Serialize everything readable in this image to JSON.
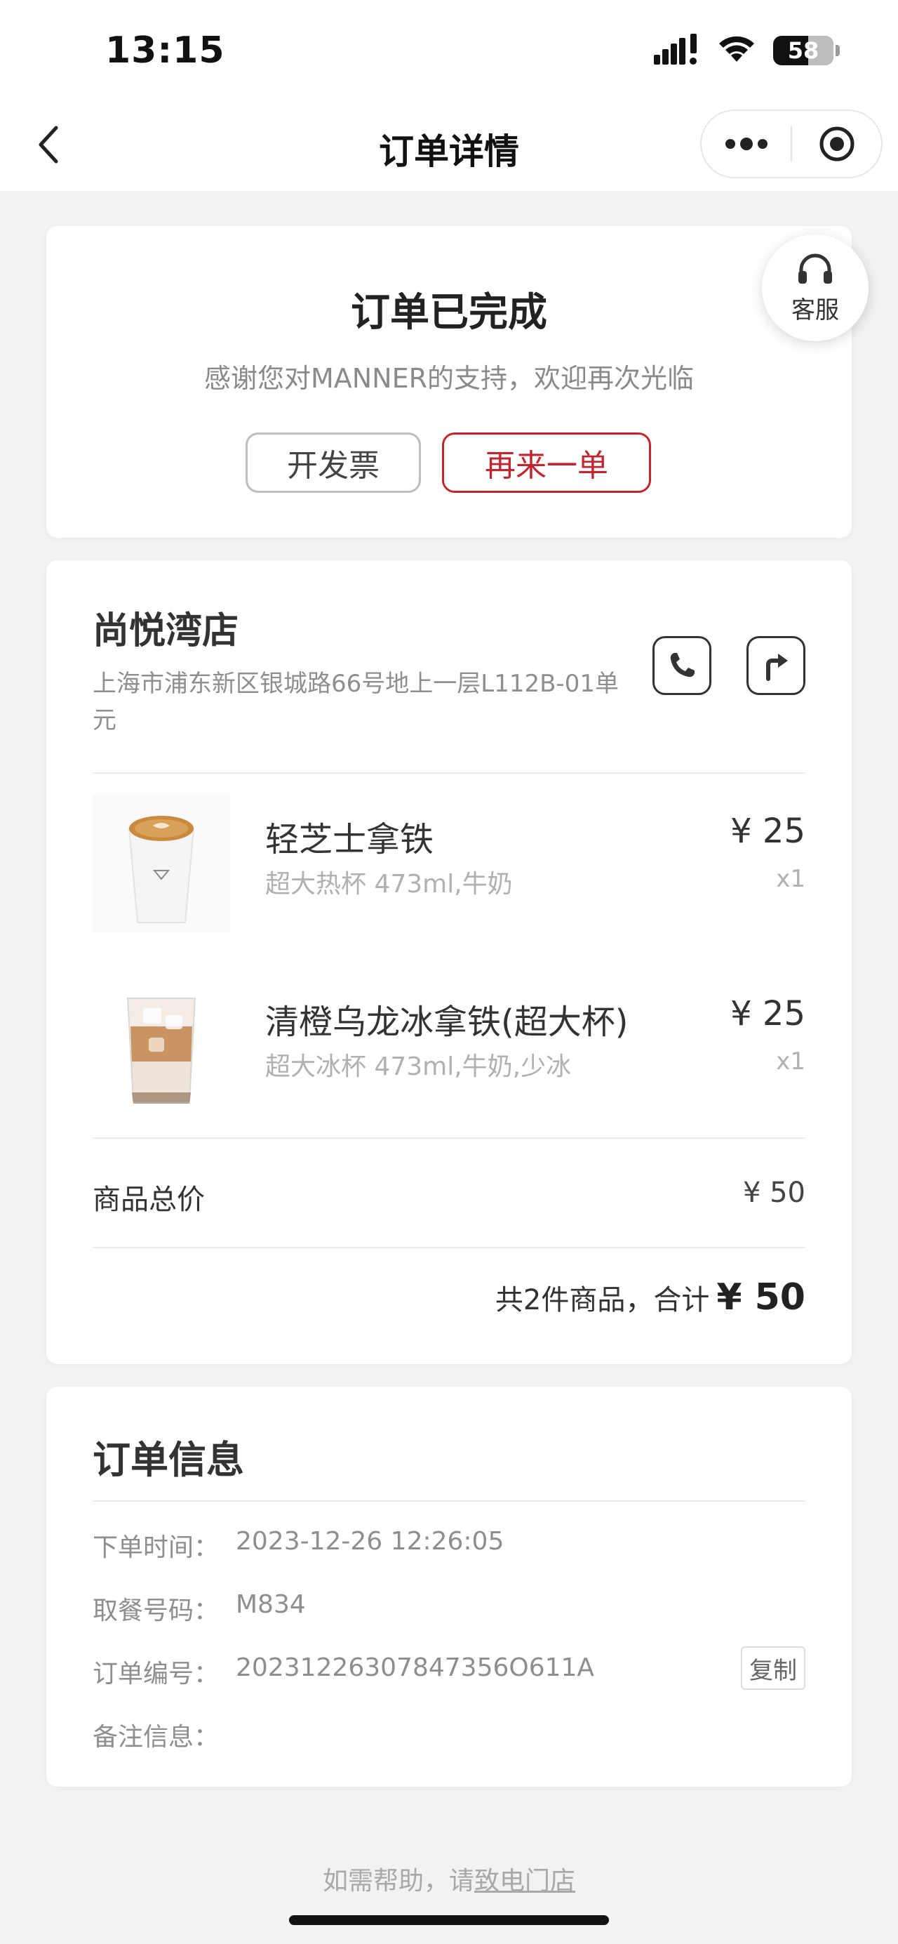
{
  "status_bar": {
    "time": "13:15",
    "battery": "58"
  },
  "nav": {
    "title": "订单详情"
  },
  "order_status": {
    "title": "订单已完成",
    "subtitle": "感谢您对MANNER的支持，欢迎再次光临",
    "invoice_label": "开发票",
    "reorder_label": "再来一单",
    "service_label": "客服"
  },
  "store": {
    "name": "尚悦湾店",
    "address": "上海市浦东新区银城路66号地上一层L112B-01单元"
  },
  "items": [
    {
      "name": "轻芝士拿铁",
      "spec": "超大热杯 473ml,牛奶",
      "price": "¥ 25",
      "qty": "x1"
    },
    {
      "name": "清橙乌龙冰拿铁(超大杯)",
      "spec": "超大冰杯 473ml,牛奶,少冰",
      "price": "¥ 25",
      "qty": "x1"
    }
  ],
  "summary": {
    "subtotal_label": "商品总价",
    "subtotal_value": "¥ 50",
    "total_text": "共2件商品，合计",
    "total_amount": "¥ 50"
  },
  "order_info": {
    "title": "订单信息",
    "rows": [
      {
        "label": "下单时间：",
        "value": "2023-12-26 12:26:05"
      },
      {
        "label": "取餐号码：",
        "value": "M834"
      },
      {
        "label": "订单编号：",
        "value": "20231226307847356O611A"
      },
      {
        "label": "备注信息：",
        "value": ""
      }
    ],
    "copy_label": "复制"
  },
  "help": {
    "prefix": "如需帮助，请",
    "link": "致电门店"
  },
  "colors": {
    "accent_red": "#c0262d",
    "background": "#f2f2f2"
  }
}
